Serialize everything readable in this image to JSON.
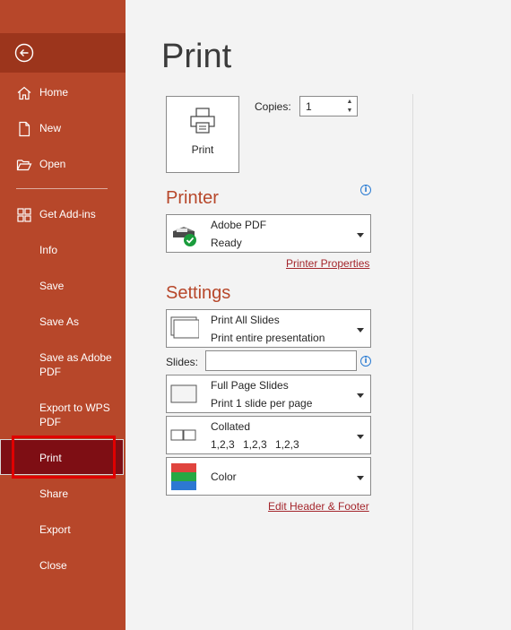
{
  "sidebar": {
    "items": [
      {
        "label": "Home",
        "icon": "home-icon"
      },
      {
        "label": "New",
        "icon": "new-document-icon"
      },
      {
        "label": "Open",
        "icon": "open-folder-icon"
      },
      {
        "label": "Get Add-ins",
        "icon": "add-ins-grid-icon"
      },
      {
        "label": "Info"
      },
      {
        "label": "Save"
      },
      {
        "label": "Save As"
      },
      {
        "label": "Save as Adobe PDF"
      },
      {
        "label": "Export to WPS PDF"
      },
      {
        "label": "Print"
      },
      {
        "label": "Share"
      },
      {
        "label": "Export"
      },
      {
        "label": "Close"
      }
    ],
    "selected": "Print",
    "colors": {
      "background": "#b7472a",
      "selected": "#7e0e14",
      "highlight_box": "#e00000"
    }
  },
  "main": {
    "title": "Print",
    "print_button_label": "Print",
    "copies_label": "Copies:",
    "copies_value": "1",
    "printer": {
      "heading": "Printer",
      "name": "Adobe PDF",
      "status": "Ready",
      "properties_link": "Printer Properties"
    },
    "settings": {
      "heading": "Settings",
      "range_title": "Print All Slides",
      "range_desc": "Print entire presentation",
      "slides_label": "Slides:",
      "slides_value": "",
      "layout_title": "Full Page Slides",
      "layout_desc": "Print 1 slide per page",
      "collate_title": "Collated",
      "collate_pages": [
        "1,2,3",
        "1,2,3",
        "1,2,3"
      ],
      "color_title": "Color",
      "header_footer_link": "Edit Header & Footer"
    },
    "accent_color": "#b7472a"
  }
}
